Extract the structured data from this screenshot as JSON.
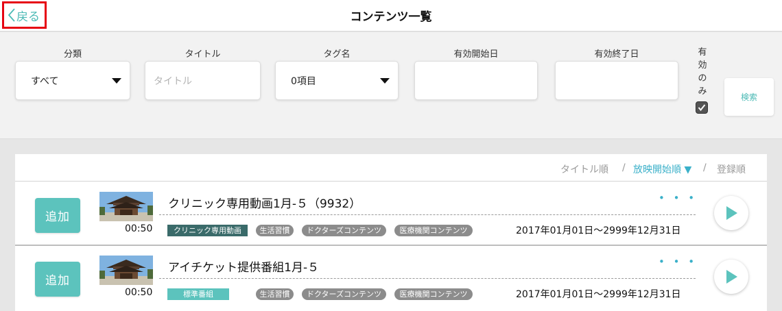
{
  "header": {
    "back_label": "戻る",
    "title": "コンテンツ一覧"
  },
  "filters": {
    "category": {
      "label": "分類",
      "value": "すべて"
    },
    "title": {
      "label": "タイトル",
      "placeholder": "タイトル"
    },
    "tag_name": {
      "label": "タグ名",
      "value": "0項目"
    },
    "start_date": {
      "label": "有効開始日",
      "value": ""
    },
    "end_date": {
      "label": "有効終了日",
      "value": ""
    },
    "valid_only": {
      "label": "有効のみ",
      "checked": true
    },
    "search_label": "検索"
  },
  "sort": {
    "options": [
      "タイトル順",
      "放映開始順 ▼",
      "登録順"
    ],
    "separator": "/",
    "active": "放映開始順 ▼"
  },
  "items": [
    {
      "add_label": "追加",
      "duration": "00:50",
      "title": "クリニック専用動画1月-５（9932）",
      "tags": [
        "クリニック専用動画",
        "生活習慣",
        "ドクターズコンテンツ",
        "医療機関コンテンツ"
      ],
      "period": "2017年01月01日〜2999年12月31日",
      "more": "• • •"
    },
    {
      "add_label": "追加",
      "duration": "00:50",
      "title": "アイチケット提供番組1月-５",
      "tags": [
        "標準番組",
        "生活習慣",
        "ドクターズコンテンツ",
        "医療機関コンテンツ"
      ],
      "period": "2017年01月01日〜2999年12月31日",
      "more": "• • •"
    }
  ],
  "colors": {
    "accent": "#4bbab5",
    "add_button": "#5cc3bd",
    "sort_active": "#3ab0c9",
    "back_highlight": "#e60012"
  }
}
